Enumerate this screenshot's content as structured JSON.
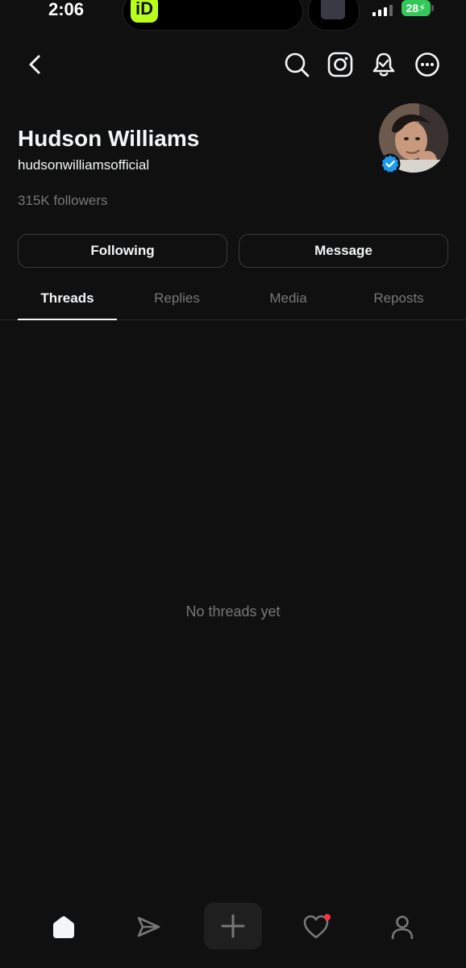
{
  "status_bar": {
    "time": "2:06",
    "battery": "28",
    "app_badge_letter": "iD",
    "accent_color": "#b9ff1e",
    "battery_color": "#34c759"
  },
  "header": {
    "icons": [
      "back-icon",
      "search-icon",
      "instagram-icon",
      "notification-bell-icon",
      "more-options-icon"
    ]
  },
  "profile": {
    "name": "Hudson Williams",
    "handle": "hudsonwilliamsofficial",
    "followers": "315K followers",
    "verified_color": "#1d9bf0"
  },
  "actions": {
    "following_label": "Following",
    "message_label": "Message"
  },
  "tabs": [
    {
      "label": "Threads",
      "active": true
    },
    {
      "label": "Replies",
      "active": false
    },
    {
      "label": "Media",
      "active": false
    },
    {
      "label": "Reposts",
      "active": false
    }
  ],
  "feed": {
    "empty_text": "No threads yet"
  },
  "bottom_nav": {
    "items": [
      "home-icon",
      "send-icon",
      "create-icon",
      "activity-heart-icon",
      "profile-icon"
    ],
    "notification_dot_color": "#ff3040"
  }
}
